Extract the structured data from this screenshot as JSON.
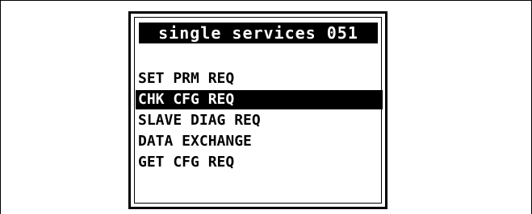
{
  "screen": {
    "title": "single services 051"
  },
  "menu": {
    "items": [
      {
        "label": "SET PRM REQ",
        "selected": false
      },
      {
        "label": "CHK CFG REQ",
        "selected": true
      },
      {
        "label": "SLAVE DIAG REQ",
        "selected": false
      },
      {
        "label": "DATA EXCHANGE",
        "selected": false
      },
      {
        "label": "GET CFG REQ",
        "selected": false
      }
    ]
  },
  "colors": {
    "display_background": "#ffffff",
    "display_foreground": "#000000",
    "selection_background": "#000000",
    "selection_foreground": "#ffffff"
  }
}
